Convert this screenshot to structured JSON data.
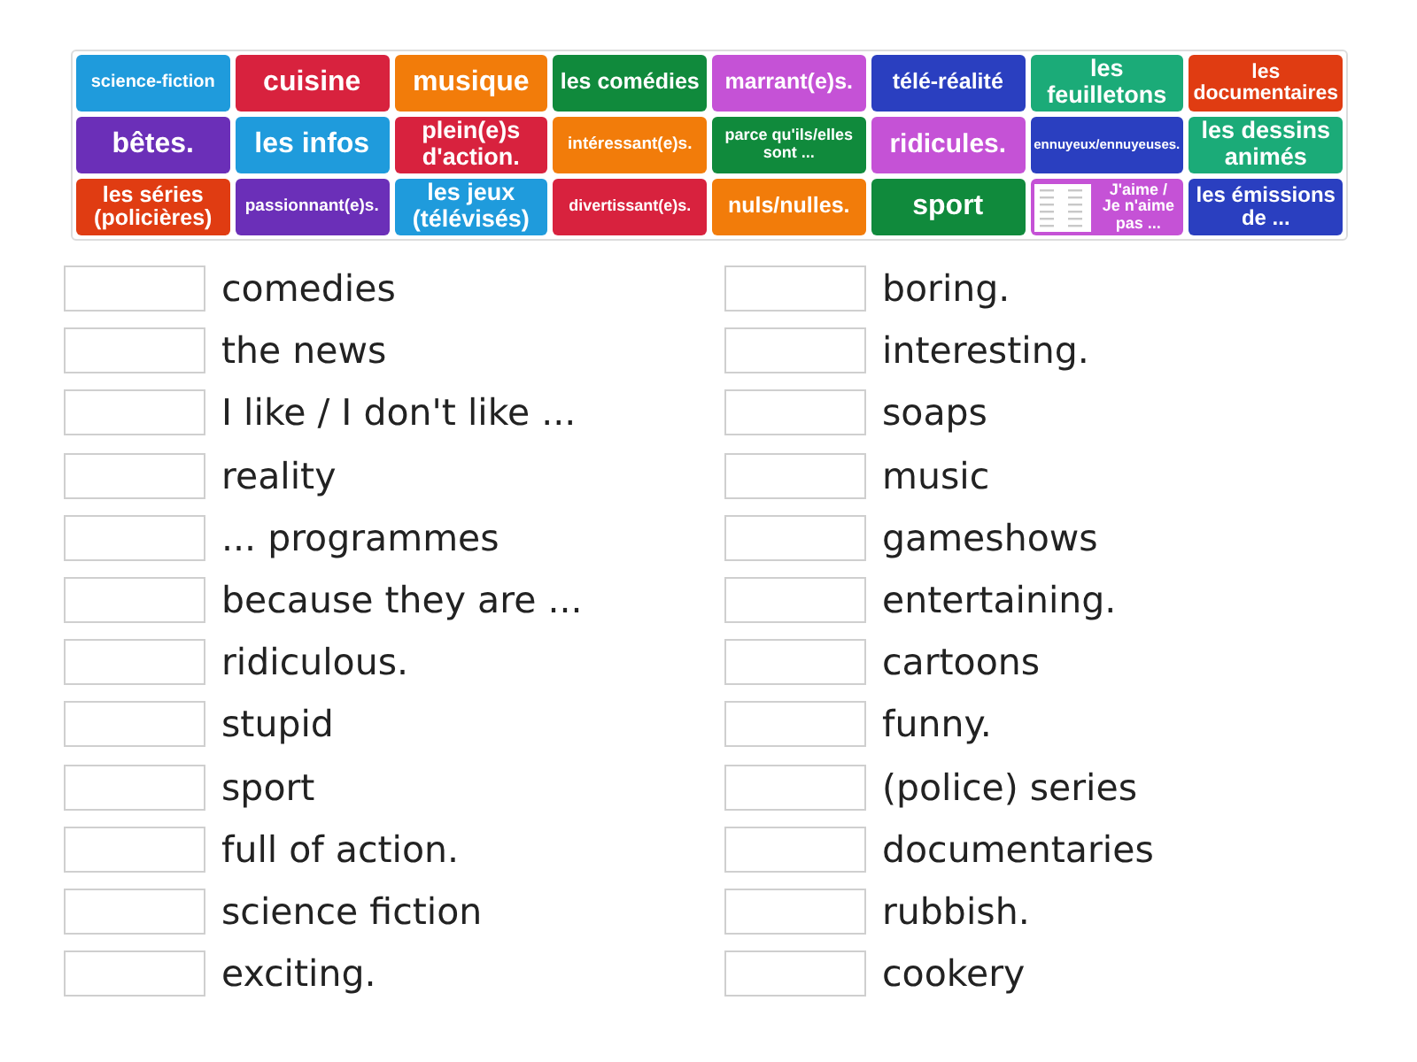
{
  "tiles": [
    {
      "kind": "text",
      "text": "science-fiction",
      "color": "#1f9bdc"
    },
    {
      "kind": "text",
      "text": "cuisine",
      "color": "#d8223e"
    },
    {
      "kind": "text",
      "text": "musique",
      "color": "#f27c0a"
    },
    {
      "kind": "text",
      "text": "les comédies",
      "color": "#108a3c"
    },
    {
      "kind": "text",
      "text": "marrant(e)s.",
      "color": "#c552d6"
    },
    {
      "kind": "text",
      "text": "télé-réalité",
      "color": "#2a3fc0"
    },
    {
      "kind": "text",
      "text": "les feuilletons",
      "color": "#1bab78"
    },
    {
      "kind": "text",
      "text": "les documentaires",
      "color": "#e03c12"
    },
    {
      "kind": "text",
      "text": "bêtes.",
      "color": "#6b2fb8"
    },
    {
      "kind": "text",
      "text": "les infos",
      "color": "#1f9bdc"
    },
    {
      "kind": "text",
      "text": "plein(e)s d'action.",
      "color": "#d8223e"
    },
    {
      "kind": "text",
      "text": "intéressant(e)s.",
      "color": "#f27c0a"
    },
    {
      "kind": "text",
      "text": "parce qu'ils/elles sont ...",
      "color": "#108a3c"
    },
    {
      "kind": "text",
      "text": "ridicules.",
      "color": "#c552d6"
    },
    {
      "kind": "text",
      "text": "ennuyeux/ennuyeuses.",
      "color": "#2a3fc0"
    },
    {
      "kind": "text",
      "text": "les dessins animés",
      "color": "#1bab78"
    },
    {
      "kind": "text",
      "text": "les séries (policières)",
      "color": "#e03c12"
    },
    {
      "kind": "text",
      "text": "passionnant(e)s.",
      "color": "#6b2fb8"
    },
    {
      "kind": "text",
      "text": "les jeux (télévisés)",
      "color": "#1f9bdc"
    },
    {
      "kind": "text",
      "text": "divertissant(e)s.",
      "color": "#d8223e"
    },
    {
      "kind": "text",
      "text": "nuls/nulles.",
      "color": "#f27c0a"
    },
    {
      "kind": "text",
      "text": "sport",
      "color": "#108a3c"
    },
    {
      "kind": "image",
      "text": "J'aime / Je n'aime pas ...",
      "color": "#c552d6"
    },
    {
      "kind": "text",
      "text": "les émissions de ...",
      "color": "#2a3fc0"
    }
  ],
  "match_columns": [
    [
      "comedies",
      "the news",
      "I like / I don't like ...",
      "reality",
      "... programmes",
      "because they are ...",
      "ridiculous.",
      "stupid",
      "sport",
      "full of action.",
      "science fiction",
      "exciting."
    ],
    [
      "boring.",
      "interesting.",
      "soaps",
      "music",
      "gameshows",
      "entertaining.",
      "cartoons",
      "funny.",
      "(police) series",
      "documentaries",
      "rubbish.",
      "cookery"
    ]
  ]
}
